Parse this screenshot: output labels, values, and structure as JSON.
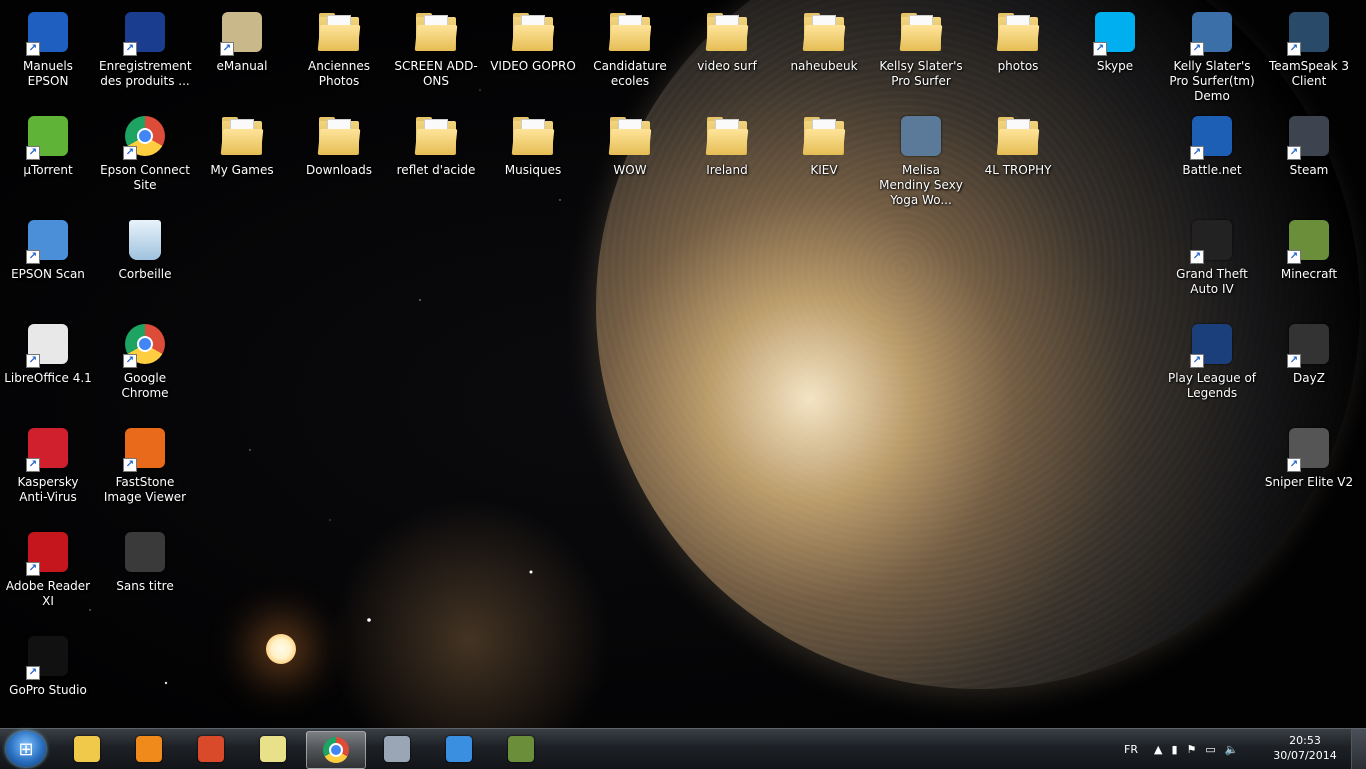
{
  "desktop": {
    "icons": [
      {
        "label": "Manuels EPSON",
        "kind": "app",
        "icon": "epson-manual-icon",
        "color": "#1f5fbf"
      },
      {
        "label": "Enregistrement des produits ...",
        "kind": "app",
        "icon": "asus-registration-icon",
        "color": "#1b3d8f"
      },
      {
        "label": "eManual",
        "kind": "app",
        "icon": "emanual-icon",
        "color": "#c9b98a"
      },
      {
        "label": "Anciennes Photos",
        "kind": "folder",
        "icon": "folder-icon"
      },
      {
        "label": "SCREEN ADD-ONS",
        "kind": "folder",
        "icon": "folder-icon"
      },
      {
        "label": "VIDEO GOPRO",
        "kind": "folder",
        "icon": "folder-icon"
      },
      {
        "label": "Candidature ecoles",
        "kind": "folder",
        "icon": "folder-icon"
      },
      {
        "label": "video surf",
        "kind": "folder",
        "icon": "folder-icon"
      },
      {
        "label": "naheubeuk",
        "kind": "folder",
        "icon": "folder-icon"
      },
      {
        "label": "Kellsy Slater's Pro Surfer",
        "kind": "folder",
        "icon": "folder-icon"
      },
      {
        "label": "photos",
        "kind": "folder",
        "icon": "folder-icon"
      },
      {
        "label": "Skype",
        "kind": "app",
        "icon": "skype-icon",
        "color": "#00aff0"
      },
      {
        "label": "Kelly Slater's Pro Surfer(tm) Demo",
        "kind": "app",
        "icon": "surfer-game-icon",
        "color": "#3b6fa8"
      },
      {
        "label": "TeamSpeak 3 Client",
        "kind": "app",
        "icon": "teamspeak-icon",
        "color": "#2a4a6a"
      },
      {
        "label": "µTorrent",
        "kind": "app",
        "icon": "utorrent-icon",
        "color": "#5fb336"
      },
      {
        "label": "Epson Connect Site",
        "kind": "app",
        "icon": "chrome-icon",
        "color": "#dd4b39"
      },
      {
        "label": "My Games",
        "kind": "folder",
        "icon": "folder-icon"
      },
      {
        "label": "Downloads",
        "kind": "folder",
        "icon": "folder-icon"
      },
      {
        "label": "reflet d'acide",
        "kind": "folder",
        "icon": "folder-icon"
      },
      {
        "label": "Musiques",
        "kind": "folder",
        "icon": "folder-icon"
      },
      {
        "label": "WOW",
        "kind": "folder",
        "icon": "folder-icon"
      },
      {
        "label": "Ireland",
        "kind": "folder",
        "icon": "folder-icon"
      },
      {
        "label": "KIEV",
        "kind": "folder",
        "icon": "folder-icon"
      },
      {
        "label": "Melisa Mendiny Sexy Yoga Wo...",
        "kind": "video",
        "icon": "video-file-icon",
        "color": "#5b7a9a"
      },
      {
        "label": "4L TROPHY",
        "kind": "folder",
        "icon": "folder-icon"
      },
      {
        "label": "Battle.net",
        "kind": "app",
        "icon": "battlenet-icon",
        "color": "#1c5fb5"
      },
      {
        "label": "Steam",
        "kind": "app",
        "icon": "steam-icon",
        "color": "#3d4450"
      },
      {
        "label": "EPSON Scan",
        "kind": "app",
        "icon": "scanner-icon",
        "color": "#4a8fd8"
      },
      {
        "label": "Corbeille",
        "kind": "system",
        "icon": "recycle-bin-icon",
        "color": "#9fc2dd"
      },
      {
        "label": "Grand Theft Auto IV",
        "kind": "app",
        "icon": "gta-iv-icon",
        "color": "#222222"
      },
      {
        "label": "Minecraft",
        "kind": "app",
        "icon": "minecraft-icon",
        "color": "#6b8e3a"
      },
      {
        "label": "LibreOffice 4.1",
        "kind": "app",
        "icon": "libreoffice-icon",
        "color": "#e8e8e8"
      },
      {
        "label": "Google Chrome",
        "kind": "app",
        "icon": "chrome-icon",
        "color": "#dd4b39"
      },
      {
        "label": "Play League of Legends",
        "kind": "app",
        "icon": "league-of-legends-icon",
        "color": "#1b3f7a"
      },
      {
        "label": "DayZ",
        "kind": "app",
        "icon": "dayz-icon",
        "color": "#333333"
      },
      {
        "label": "Kaspersky Anti-Virus",
        "kind": "app",
        "icon": "kaspersky-icon",
        "color": "#d0202e"
      },
      {
        "label": "FastStone Image Viewer",
        "kind": "app",
        "icon": "faststone-icon",
        "color": "#e86a1a"
      },
      {
        "label": "Sniper Elite V2",
        "kind": "app",
        "icon": "sniper-elite-icon",
        "color": "#555555"
      },
      {
        "label": "Adobe Reader XI",
        "kind": "app",
        "icon": "adobe-reader-icon",
        "color": "#c4161c"
      },
      {
        "label": "Sans titre",
        "kind": "image",
        "icon": "image-file-icon",
        "color": "#3a3a3a"
      },
      {
        "label": "GoPro Studio",
        "kind": "app",
        "icon": "gopro-icon",
        "color": "#111111"
      }
    ]
  },
  "taskbar": {
    "start_icon": "windows-orb-icon",
    "pinned": [
      {
        "name": "explorer",
        "icon": "folder-icon",
        "color": "#f0c84a"
      },
      {
        "name": "media",
        "icon": "media-player-icon",
        "color": "#f08a1a"
      },
      {
        "name": "paint",
        "icon": "paint-icon",
        "color": "#d84a2a"
      },
      {
        "name": "sticky",
        "icon": "sticky-notes-icon",
        "color": "#e9e08a"
      },
      {
        "name": "chrome",
        "icon": "chrome-icon",
        "color": "#dd4b39",
        "active": true
      },
      {
        "name": "steam",
        "icon": "steam-icon",
        "color": "#9aa5b5"
      },
      {
        "name": "battlenet",
        "icon": "battlenet-icon",
        "color": "#3a8fe0"
      },
      {
        "name": "minecraft",
        "icon": "minecraft-icon",
        "color": "#6b8e3a"
      }
    ],
    "tray": {
      "language": "FR",
      "time": "20:53",
      "date": "30/07/2014"
    }
  }
}
